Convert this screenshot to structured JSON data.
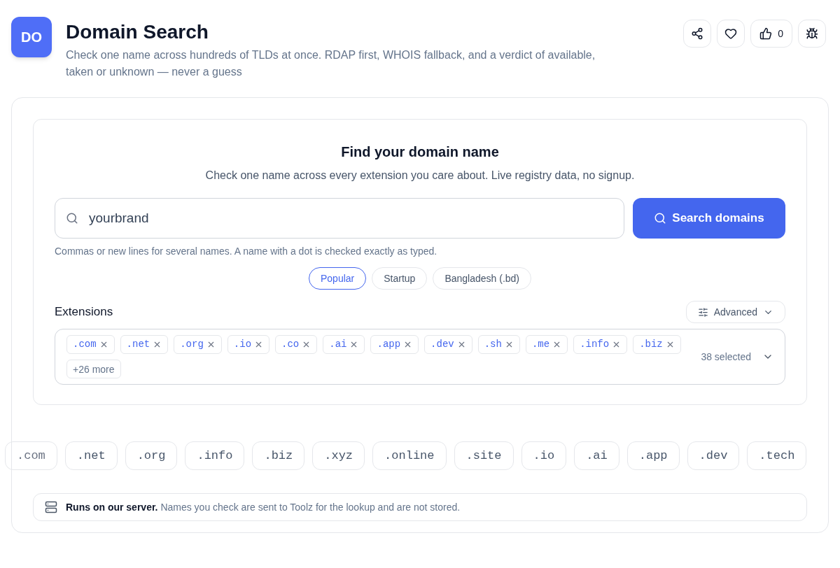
{
  "header": {
    "logo": "DO",
    "title": "Domain Search",
    "description": "Check one name across hundreds of TLDs at once. RDAP first, WHOIS fallback, and a verdict of available, taken or unknown — never a guess",
    "likes": "0"
  },
  "search_card": {
    "title": "Find your domain name",
    "subtitle": "Check one name across every extension you care about. Live registry data, no signup.",
    "search": {
      "value": "yourbrand"
    },
    "button": "Search domains",
    "hint": "Commas or new lines for several names. A name with a dot is checked exactly as typed.",
    "presets": [
      {
        "label": "Popular",
        "selected": true
      },
      {
        "label": "Startup",
        "selected": false
      },
      {
        "label": "Bangladesh (.bd)",
        "selected": false
      }
    ],
    "extensions_label": "Extensions",
    "advanced": "Advanced",
    "tags": [
      ".com",
      ".net",
      ".org",
      ".io",
      ".co",
      ".ai",
      ".app",
      ".dev",
      ".sh",
      ".me",
      ".info",
      ".biz"
    ],
    "more": "+26 more",
    "selected_count": "38 selected"
  },
  "tld_strip": [
    ".com",
    ".net",
    ".org",
    ".info",
    ".biz",
    ".xyz",
    ".online",
    ".site",
    ".io",
    ".ai",
    ".app",
    ".dev",
    ".tech"
  ],
  "notice": {
    "bold": "Runs on our server.",
    "text": "Names you check are sent to Toolz for the lookup and are not stored."
  }
}
